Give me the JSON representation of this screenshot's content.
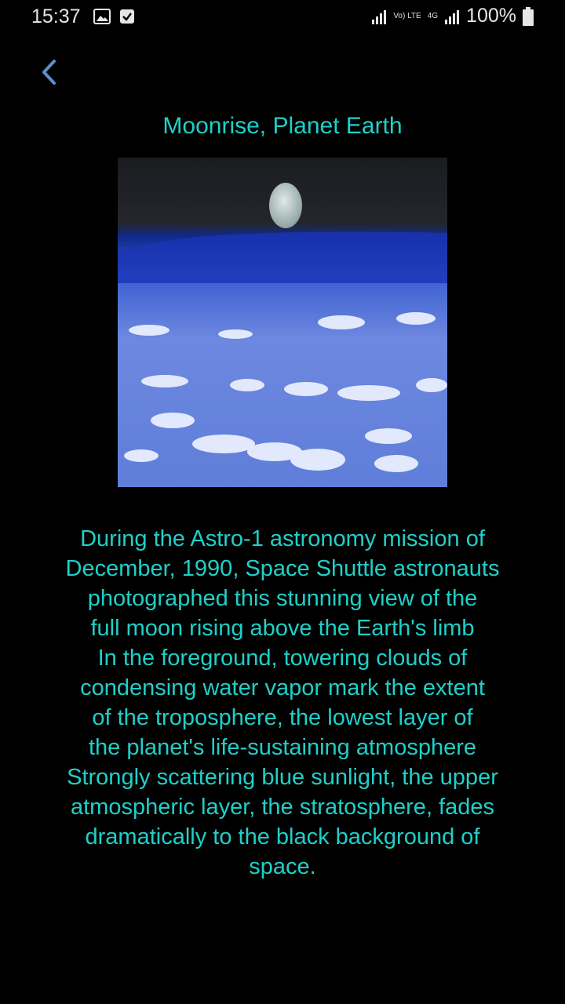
{
  "status_bar": {
    "time": "15:37",
    "network": "4G",
    "volte": "Vo) LTE",
    "battery": "100%"
  },
  "page": {
    "title": "Moonrise, Planet Earth",
    "description": "During the Astro-1 astronomy mission of\nDecember, 1990, Space Shuttle astronauts\nphotographed this stunning view of the\nfull moon rising above the Earth's limb\nIn the foreground, towering clouds of\ncondensing water vapor mark the extent\nof the troposphere, the lowest layer of\nthe planet's life-sustaining atmosphere\nStrongly scattering blue sunlight, the upper\natmospheric layer, the stratosphere, fades\ndramatically to the black background of\nspace."
  },
  "colors": {
    "accent": "#1fd0c8",
    "background": "#000000",
    "back_arrow": "#5b8fc8"
  },
  "icons": [
    "gallery-icon",
    "check-icon",
    "signal-icon",
    "battery-icon",
    "back-arrow-icon"
  ]
}
